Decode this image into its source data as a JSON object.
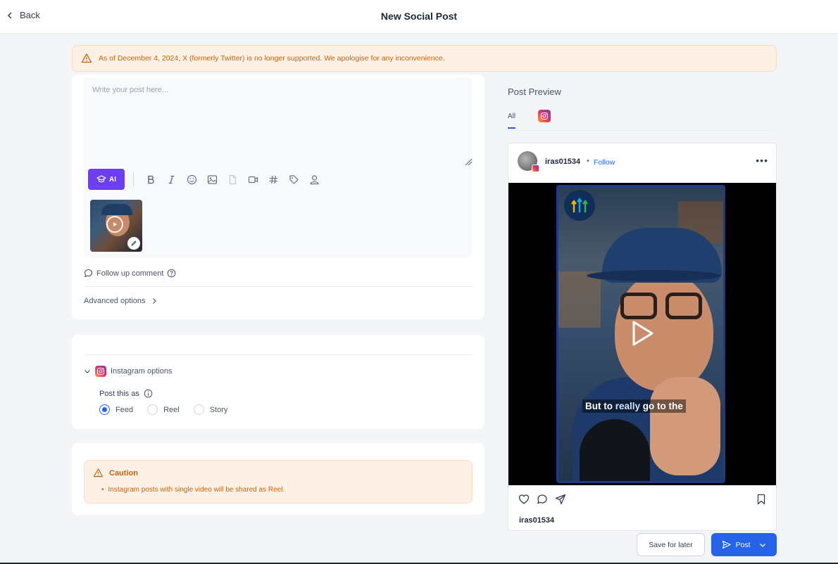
{
  "header": {
    "back_label": "Back",
    "title": "New Social Post"
  },
  "banner": {
    "text": "As of December 4, 2024, X (formerly Twitter) is no longer supported. We apologise for any inconvenience."
  },
  "composer": {
    "placeholder": "Write your post here...",
    "value": "",
    "ai_label": "AI",
    "toolbar_icons": [
      "bold-icon",
      "italic-icon",
      "emoji-icon",
      "image-icon",
      "file-icon",
      "video-icon",
      "hashtag-icon",
      "tag-icon",
      "person-icon"
    ],
    "followup_label": "Follow up comment",
    "advanced_label": "Advanced options"
  },
  "instagram_options": {
    "header_label": "Instagram options",
    "post_as_label": "Post this as",
    "options": [
      "Feed",
      "Reel",
      "Story"
    ],
    "selected": "Feed"
  },
  "caution": {
    "title": "Caution",
    "items": [
      "Instagram posts with single video will be shared as Reel."
    ]
  },
  "preview": {
    "title": "Post Preview",
    "tabs": [
      "All"
    ],
    "active_tab": "All",
    "username": "iras01534",
    "separator": "•",
    "follow_label": "Follow",
    "more_label": "•••",
    "caption_user": "iras01534",
    "video_caption_before": "But to ",
    "video_caption_highlight": "really",
    "video_caption_after": " go to the"
  },
  "footer": {
    "save_label": "Save for later",
    "post_label": "Post"
  },
  "colors": {
    "accent": "#2563eb",
    "ai_purple": "#6d3ef3",
    "warning_bg": "#fdf0e4",
    "warning_text": "#c4640f"
  }
}
